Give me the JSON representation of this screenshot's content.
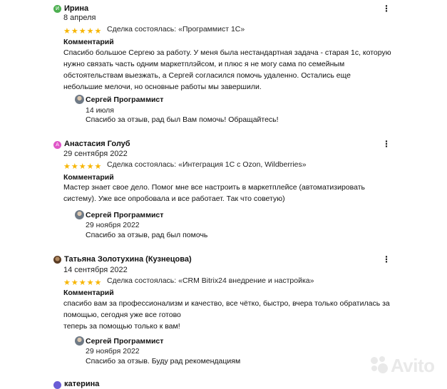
{
  "colors": {
    "star": "#f7b500",
    "avatar_irina": "#4caf50",
    "avatar_anastasia": "#e056c8",
    "avatar_last": "#6a5cd6"
  },
  "reviews": [
    {
      "initial": "И",
      "name": "Ирина",
      "date": "8 апреля",
      "stars": [
        "★",
        "★",
        "★",
        "★",
        "★"
      ],
      "deal": "Сделка состоялась: «Программист 1С»",
      "comment_label": "Комментарий",
      "comment_lines": [
        "Спасибо большое Сергею за работу. У меня была нестандартная задача - старая 1с, которую",
        "нужно связать часть одним маркетплэйсом, и плюс я не могу сама по семейным",
        "обстоятельствам выезжать, а Сергей согласился помочь удаленно. Остались еще",
        "небольшие мелочи, но основные работы мы завершили."
      ],
      "reply": {
        "name": "Сергей Программист",
        "date": "14 июля",
        "text": "Спасибо за отзыв, рад был Вам помочь! Обращайтесь!"
      }
    },
    {
      "initial": "А",
      "name": "Анастасия Голуб",
      "date": "29 сентября 2022",
      "stars": [
        "★",
        "★",
        "★",
        "★",
        "★"
      ],
      "deal": "Сделка состоялась: «Интеграция 1С с Ozon, Wildberries»",
      "comment_label": "Комментарий",
      "comment_lines": [
        "Мастер знает свое дело. Помог мне все настроить в маркетплейсе (автоматизировать",
        "систему). Уже все опробовала и все работает. Так что советую)"
      ],
      "reply": {
        "name": "Сергей Программист",
        "date": "29 ноября 2022",
        "text": "Спасибо за отзыв, рад был помочь"
      }
    },
    {
      "initial": "",
      "name": "Татьяна Золотухина (Кузнецова)",
      "date": "14 сентября 2022",
      "stars": [
        "★",
        "★",
        "★",
        "★",
        "★"
      ],
      "deal": "Сделка состоялась: «CRM Bitrix24 внедрение и настройка»",
      "comment_label": "Комментарий",
      "comment_lines": [
        "спасибо вам за профессионализм и качество, все чётко, быстро, вчера только обратилась за",
        "помощью, сегодня уже все готово",
        "теперь за помощью только к вам!"
      ],
      "reply": {
        "name": "Сергей Программист",
        "date": "29 ноября 2022",
        "text": "Спасибо за отзыв. Буду рад рекомендациям"
      }
    }
  ],
  "next_review": {
    "initial": "",
    "name": "катерина"
  },
  "menu_icon": "⋮",
  "watermark": "Avito"
}
